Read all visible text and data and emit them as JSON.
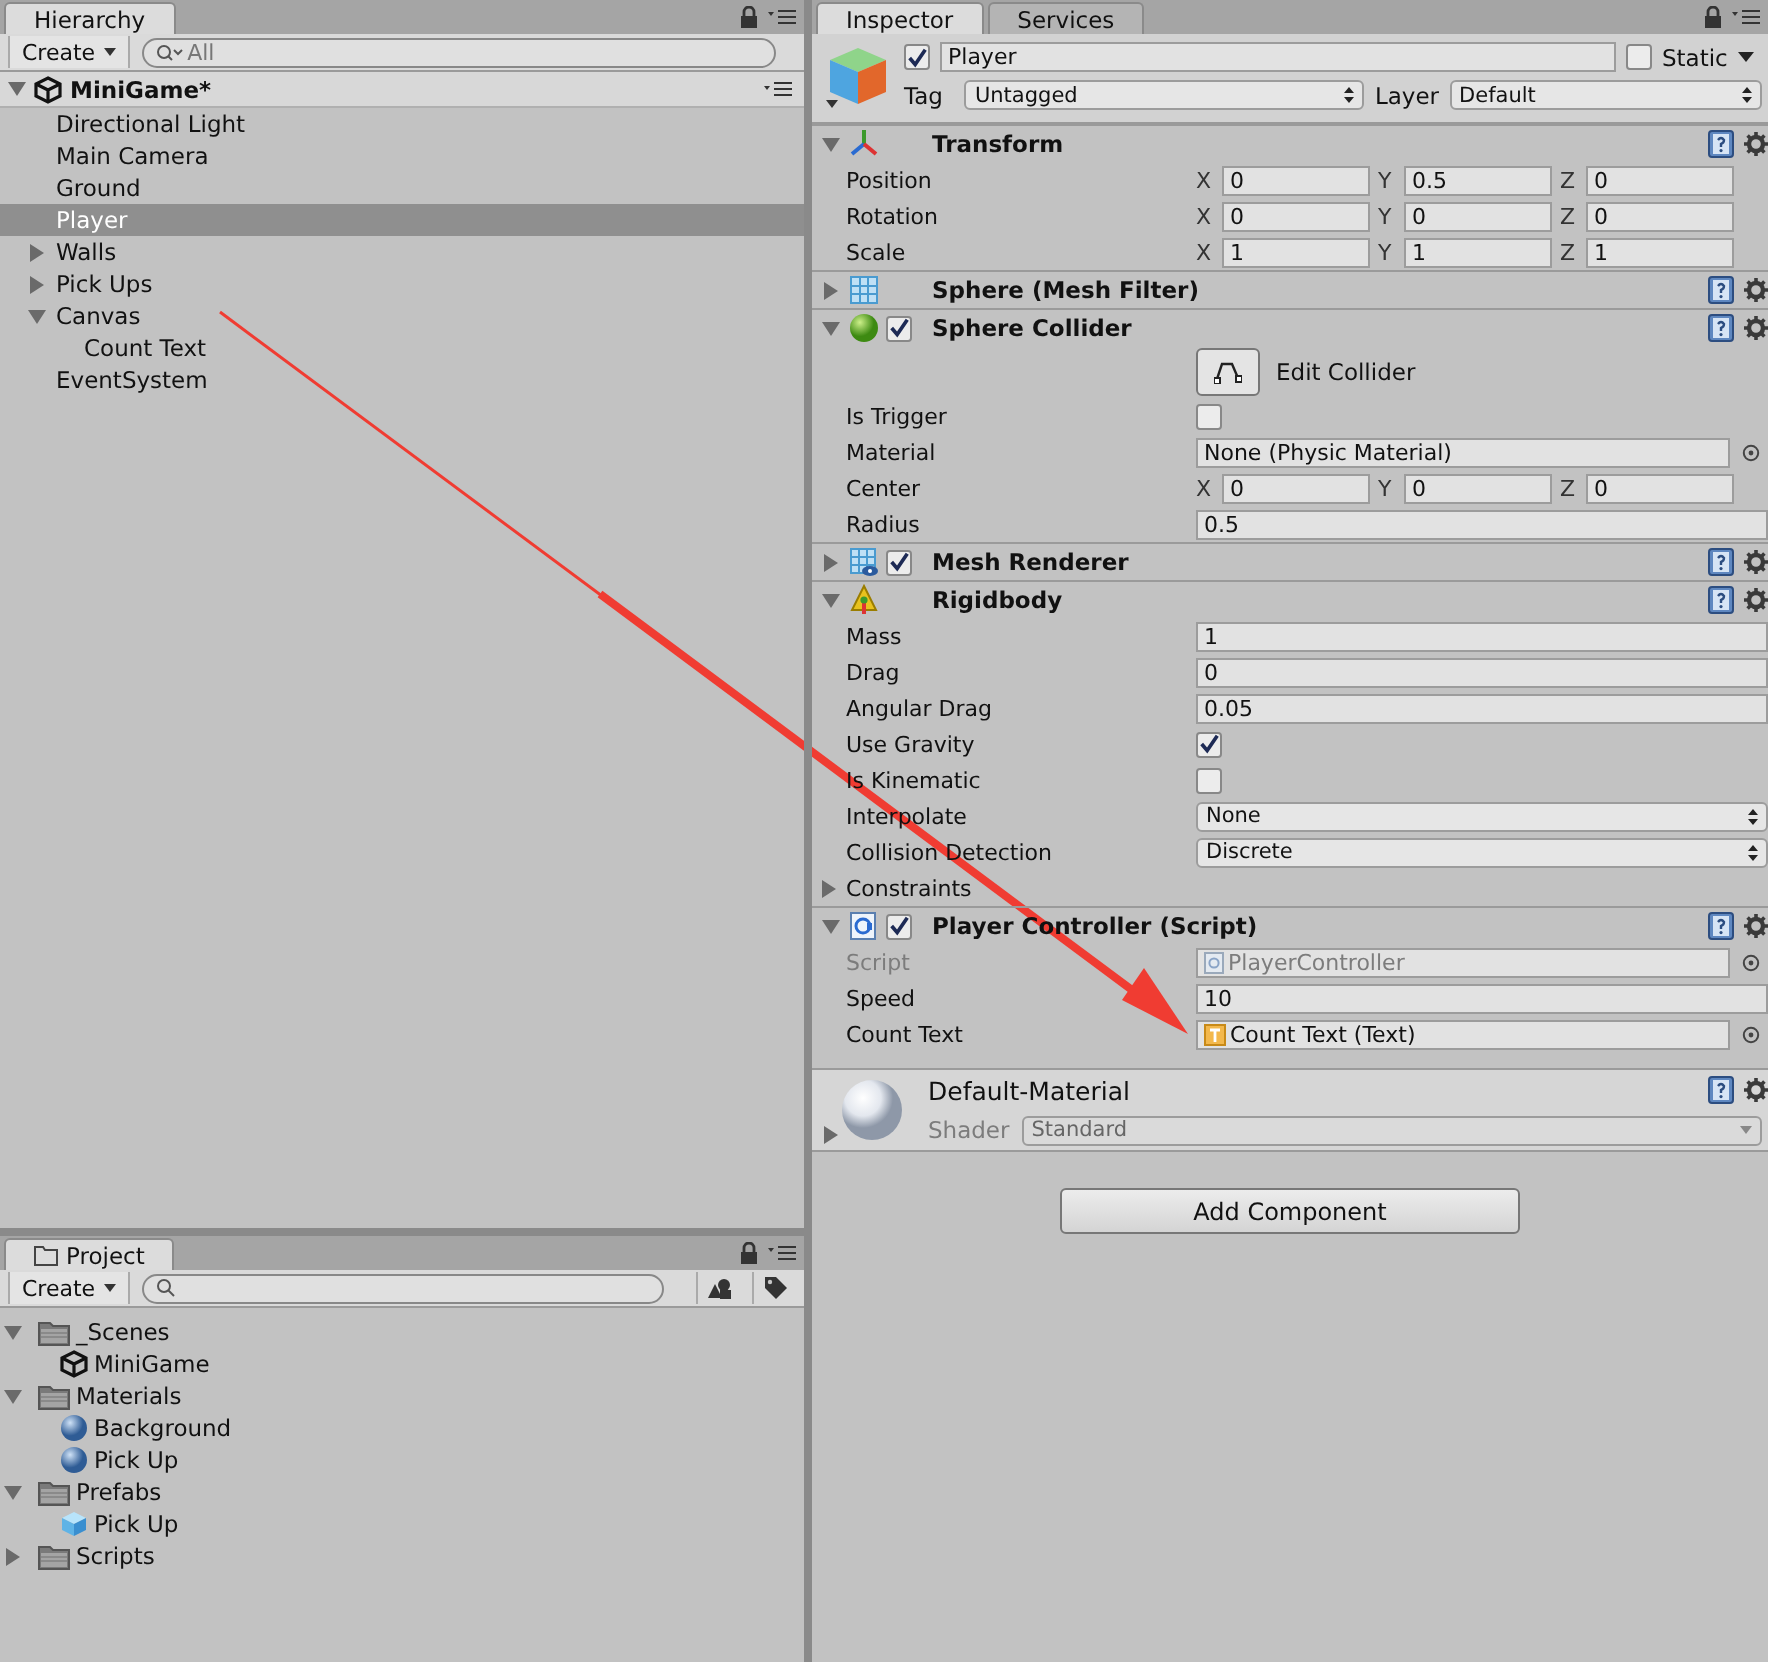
{
  "hierarchy": {
    "tab": "Hierarchy",
    "create": "Create",
    "search": "All",
    "scene": "MiniGame*",
    "items": [
      {
        "label": "Directional Light",
        "selected": false
      },
      {
        "label": "Main Camera",
        "selected": false
      },
      {
        "label": "Ground",
        "selected": false
      },
      {
        "label": "Player",
        "selected": true
      },
      {
        "label": "Walls",
        "selected": false,
        "expanded": false
      },
      {
        "label": "Pick Ups",
        "selected": false,
        "expanded": false
      },
      {
        "label": "Canvas",
        "selected": false,
        "expanded": true,
        "children": [
          {
            "label": "Count Text",
            "selected": false
          }
        ]
      },
      {
        "label": "EventSystem",
        "selected": false
      }
    ]
  },
  "project": {
    "tab": "Project",
    "create": "Create",
    "items": [
      {
        "label": "_Scenes",
        "kind": "folder",
        "expanded": true,
        "children": [
          {
            "label": "MiniGame",
            "kind": "scene"
          }
        ]
      },
      {
        "label": "Materials",
        "kind": "folder",
        "expanded": true,
        "children": [
          {
            "label": "Background",
            "kind": "material"
          },
          {
            "label": "Pick Up",
            "kind": "material"
          }
        ]
      },
      {
        "label": "Prefabs",
        "kind": "folder",
        "expanded": true,
        "children": [
          {
            "label": "Pick Up",
            "kind": "prefab"
          }
        ]
      },
      {
        "label": "Scripts",
        "kind": "folder",
        "expanded": false
      }
    ]
  },
  "inspector": {
    "tabs": [
      {
        "label": "Inspector",
        "selected": true
      },
      {
        "label": "Services",
        "selected": false
      }
    ],
    "object": {
      "name": "Player",
      "active": true,
      "static_label": "Static",
      "static": false,
      "tag_label": "Tag",
      "tag": "Untagged",
      "layer_label": "Layer",
      "layer": "Default"
    },
    "components": [
      {
        "title": "Transform",
        "kind": "transform",
        "expanded": true,
        "rows": [
          {
            "kind": "vector3",
            "label": "Position",
            "axes": [
              {
                "axis": "X",
                "value": "0"
              },
              {
                "axis": "Y",
                "value": "0.5"
              },
              {
                "axis": "Z",
                "value": "0"
              }
            ]
          },
          {
            "kind": "vector3",
            "label": "Rotation",
            "axes": [
              {
                "axis": "X",
                "value": "0"
              },
              {
                "axis": "Y",
                "value": "0"
              },
              {
                "axis": "Z",
                "value": "0"
              }
            ]
          },
          {
            "kind": "vector3",
            "label": "Scale",
            "axes": [
              {
                "axis": "X",
                "value": "1"
              },
              {
                "axis": "Y",
                "value": "1"
              },
              {
                "axis": "Z",
                "value": "1"
              }
            ]
          }
        ]
      },
      {
        "title": "Sphere (Mesh Filter)",
        "kind": "mesh-filter",
        "expanded": false
      },
      {
        "title": "Sphere Collider",
        "kind": "sphere-collider",
        "expanded": true,
        "enabled": true,
        "rows": [
          {
            "kind": "button",
            "label": "Edit Collider"
          },
          {
            "kind": "checkbox",
            "label": "Is Trigger",
            "checked": false
          },
          {
            "kind": "object",
            "label": "Material",
            "value": "None (Physic Material)"
          },
          {
            "kind": "vector3",
            "label": "Center",
            "axes": [
              {
                "axis": "X",
                "value": "0"
              },
              {
                "axis": "Y",
                "value": "0"
              },
              {
                "axis": "Z",
                "value": "0"
              }
            ]
          },
          {
            "kind": "field",
            "label": "Radius",
            "value": "0.5"
          }
        ]
      },
      {
        "title": "Mesh Renderer",
        "kind": "mesh-renderer",
        "expanded": false,
        "enabled": true
      },
      {
        "title": "Rigidbody",
        "kind": "rigidbody",
        "expanded": true,
        "rows": [
          {
            "kind": "field",
            "label": "Mass",
            "value": "1"
          },
          {
            "kind": "field",
            "label": "Drag",
            "value": "0"
          },
          {
            "kind": "field",
            "label": "Angular Drag",
            "value": "0.05"
          },
          {
            "kind": "checkbox",
            "label": "Use Gravity",
            "checked": true
          },
          {
            "kind": "checkbox",
            "label": "Is Kinematic",
            "checked": false
          },
          {
            "kind": "dropdown",
            "label": "Interpolate",
            "value": "None"
          },
          {
            "kind": "dropdown",
            "label": "Collision Detection",
            "value": "Discrete"
          },
          {
            "kind": "foldout",
            "label": "Constraints",
            "expanded": false
          }
        ]
      },
      {
        "title": "Player Controller (Script)",
        "kind": "script",
        "expanded": true,
        "enabled": true,
        "rows": [
          {
            "kind": "script",
            "label": "Script",
            "value": "PlayerController"
          },
          {
            "kind": "field",
            "label": "Speed",
            "value": "10"
          },
          {
            "kind": "text-ref",
            "label": "Count Text",
            "value": "Count Text (Text)"
          }
        ]
      }
    ],
    "material": {
      "name": "Default-Material",
      "shader_label": "Shader",
      "shader": "Standard",
      "expanded": false
    },
    "add_component": "Add Component"
  }
}
